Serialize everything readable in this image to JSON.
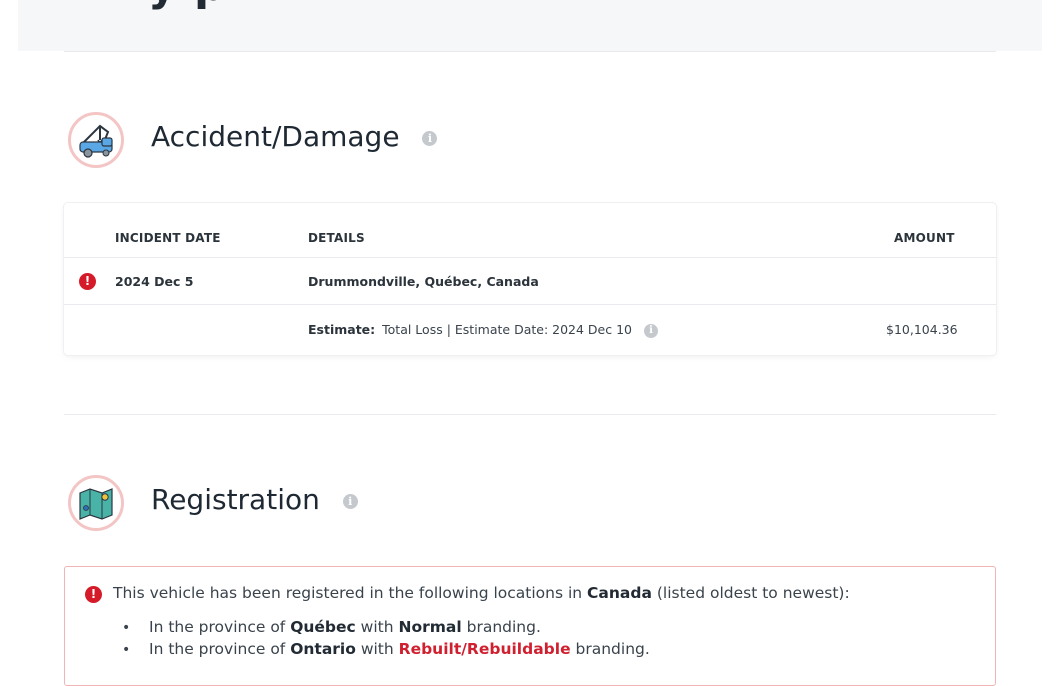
{
  "header": {
    "cut_title": "y p"
  },
  "accident": {
    "title": "Accident/Damage",
    "info_icon": "info-icon",
    "columns": {
      "date": "INCIDENT DATE",
      "details": "DETAILS",
      "amount": "AMOUNT"
    },
    "incident": {
      "date": "2024 Dec 5",
      "location": "Drummondville, Québec, Canada",
      "estimate_label": "Estimate:",
      "estimate_text": "Total Loss | Estimate Date: 2024 Dec 10",
      "amount": "$10,104.36"
    },
    "colors": {
      "alert": "#d51b2a"
    }
  },
  "registration": {
    "title": "Registration",
    "intro_pre": "This vehicle has been registered in the following locations in ",
    "country": "Canada",
    "intro_post": " (listed oldest to newest):",
    "bullet": "•",
    "items": [
      {
        "pre": "In the province of ",
        "province": "Québec",
        "mid": " with ",
        "brand": "Normal",
        "post": " branding."
      },
      {
        "pre": "In the province of ",
        "province": "Ontario",
        "mid": " with ",
        "brand": "Rebuilt/Rebuildable",
        "post": " branding."
      }
    ],
    "colors": {
      "brand_alert": "#d01f2e",
      "border": "#f0b4b4"
    }
  }
}
